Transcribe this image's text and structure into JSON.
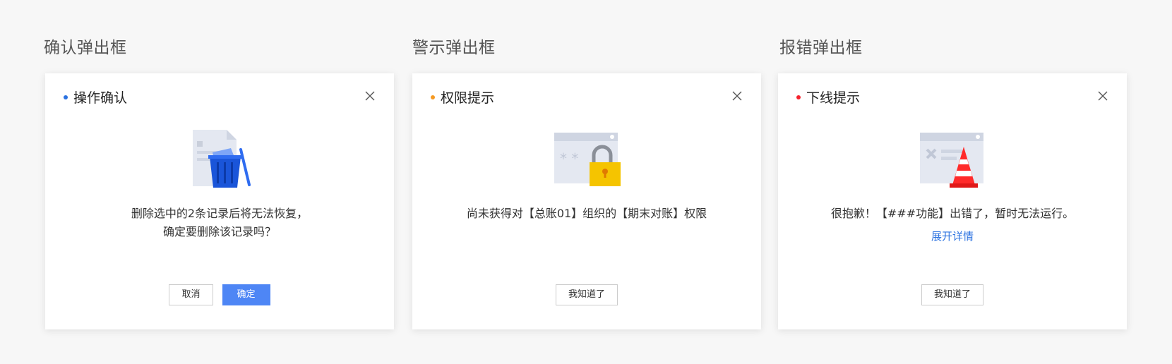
{
  "sections": [
    {
      "title": "确认弹出框",
      "dialog": {
        "title": "操作确认",
        "dot_color": "#2b72e0",
        "illustration": "trash-icon",
        "message_lines": [
          "删除选中的2条记录后将无法恢复，",
          "确定要删除该记录吗？"
        ],
        "buttons": {
          "cancel": "取消",
          "confirm": "确定"
        }
      }
    },
    {
      "title": "警示弹出框",
      "dialog": {
        "title": "权限提示",
        "dot_color": "#f59a23",
        "illustration": "lock-icon",
        "message_lines": [
          "尚未获得对【总账01】组织的【期末对账】权限"
        ],
        "buttons": {
          "ok": "我知道了"
        }
      }
    },
    {
      "title": "报错弹出框",
      "dialog": {
        "title": "下线提示",
        "dot_color": "#f5222d",
        "illustration": "traffic-cone-icon",
        "message_lines": [
          "很抱歉！【###功能】出错了，暂时无法运行。"
        ],
        "link": "展开详情",
        "buttons": {
          "ok": "我知道了"
        }
      }
    }
  ],
  "colors": {
    "primary": "#4e86f5",
    "link": "#2b72e0"
  }
}
